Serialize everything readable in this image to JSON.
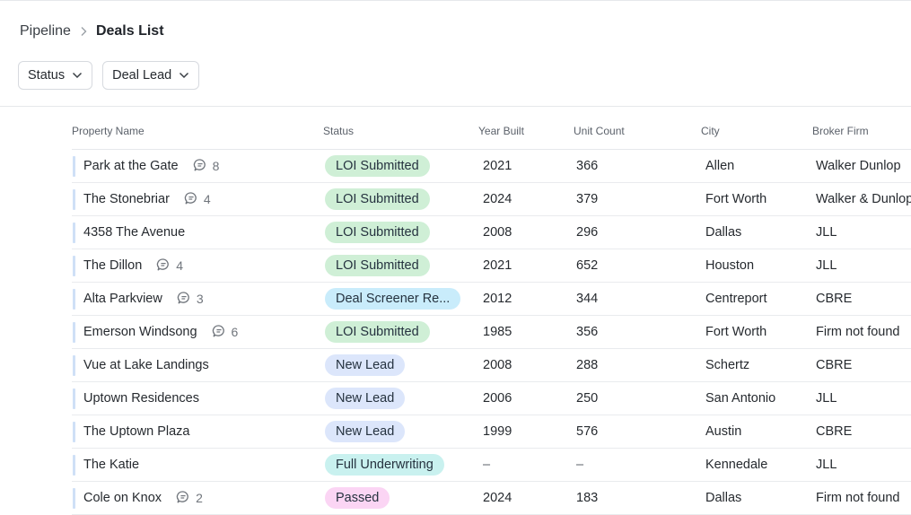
{
  "breadcrumb": {
    "root": "Pipeline",
    "current": "Deals List"
  },
  "filters": [
    {
      "label": "Status"
    },
    {
      "label": "Deal Lead"
    }
  ],
  "table": {
    "headers": {
      "property_name": "Property Name",
      "status": "Status",
      "year_built": "Year Built",
      "unit_count": "Unit Count",
      "city": "City",
      "broker_firm": "Broker Firm"
    },
    "rows": [
      {
        "name": "Park at the Gate",
        "comments": "8",
        "status": "LOI Submitted",
        "status_kind": "loi",
        "year": "2021",
        "units": "366",
        "city": "Allen",
        "broker": "Walker Dunlop"
      },
      {
        "name": "The Stonebriar",
        "comments": "4",
        "status": "LOI Submitted",
        "status_kind": "loi",
        "year": "2024",
        "units": "379",
        "city": "Fort Worth",
        "broker": "Walker & Dunlop"
      },
      {
        "name": "4358 The Avenue",
        "comments": "",
        "status": "LOI Submitted",
        "status_kind": "loi",
        "year": "2008",
        "units": "296",
        "city": "Dallas",
        "broker": "JLL"
      },
      {
        "name": "The Dillon",
        "comments": "4",
        "status": "LOI Submitted",
        "status_kind": "loi",
        "year": "2021",
        "units": "652",
        "city": "Houston",
        "broker": "JLL"
      },
      {
        "name": "Alta Parkview",
        "comments": "3",
        "status": "Deal Screener Re...",
        "status_kind": "screener",
        "year": "2012",
        "units": "344",
        "city": "Centreport",
        "broker": "CBRE"
      },
      {
        "name": "Emerson Windsong",
        "comments": "6",
        "status": "LOI Submitted",
        "status_kind": "loi",
        "year": "1985",
        "units": "356",
        "city": "Fort Worth",
        "broker": "Firm not found"
      },
      {
        "name": "Vue at Lake Landings",
        "comments": "",
        "status": "New Lead",
        "status_kind": "new",
        "year": "2008",
        "units": "288",
        "city": "Schertz",
        "broker": "CBRE"
      },
      {
        "name": "Uptown Residences",
        "comments": "",
        "status": "New Lead",
        "status_kind": "new",
        "year": "2006",
        "units": "250",
        "city": "San Antonio",
        "broker": "JLL"
      },
      {
        "name": "The Uptown Plaza",
        "comments": "",
        "status": "New Lead",
        "status_kind": "new",
        "year": "1999",
        "units": "576",
        "city": "Austin",
        "broker": "CBRE"
      },
      {
        "name": "The Katie",
        "comments": "",
        "status": "Full Underwriting",
        "status_kind": "full",
        "year": "–",
        "units": "–",
        "city": "Kennedale",
        "broker": "JLL"
      },
      {
        "name": "Cole on Knox",
        "comments": "2",
        "status": "Passed",
        "status_kind": "passed",
        "year": "2024",
        "units": "183",
        "city": "Dallas",
        "broker": "Firm not found"
      }
    ]
  },
  "icons": {
    "comment": "comment-bubble-icon",
    "chevron": "chevron-down-icon",
    "separator": "chevron-right-icon"
  }
}
